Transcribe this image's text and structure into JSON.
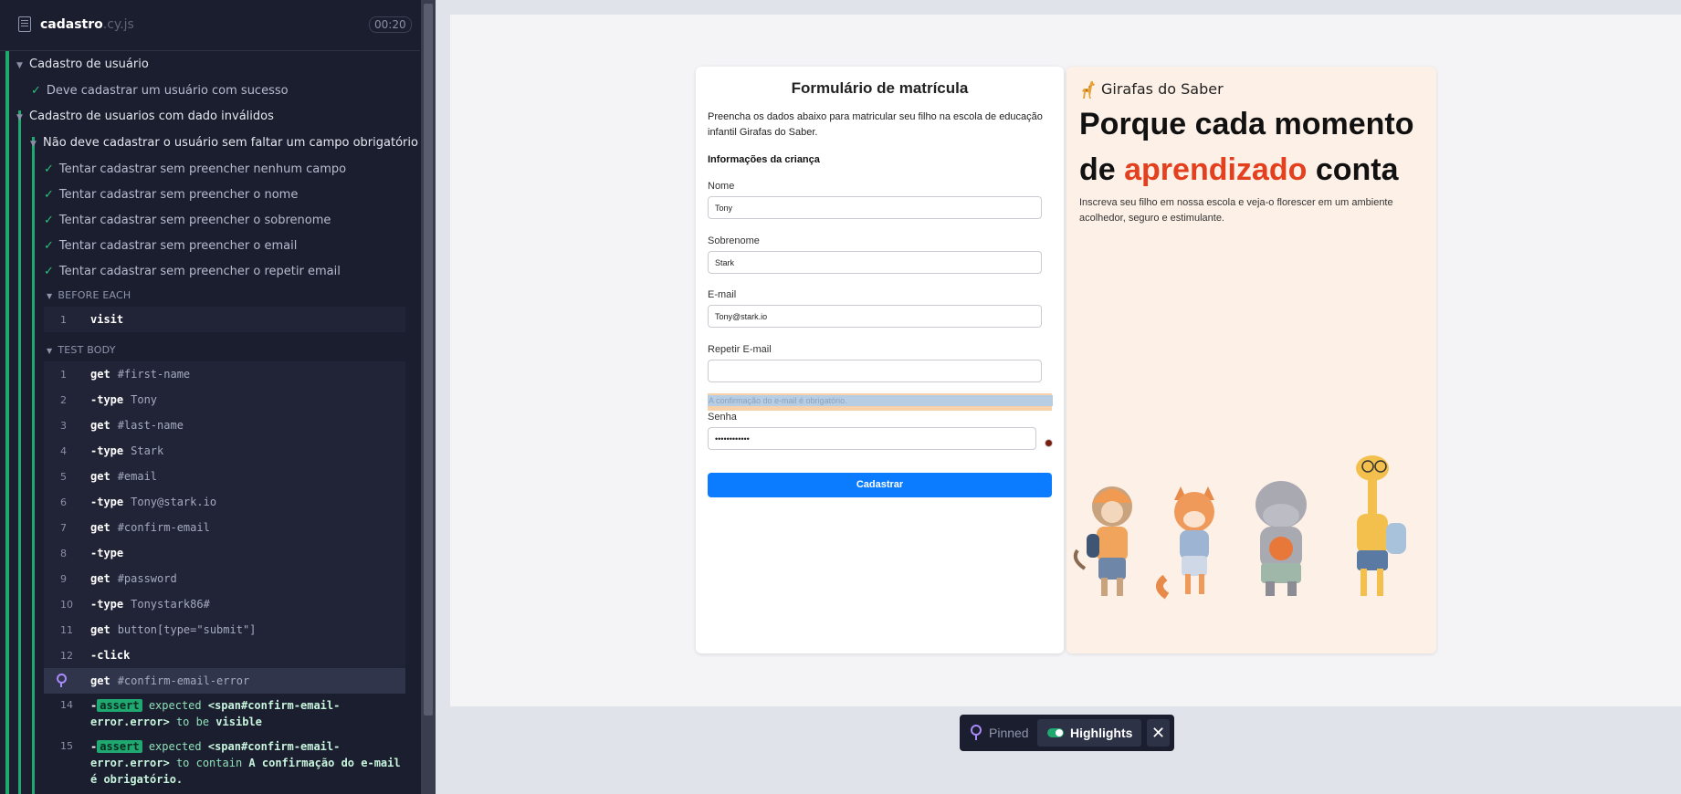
{
  "reporter": {
    "spec_name": "cadastro",
    "spec_ext": ".cy.js",
    "duration": "00:20",
    "suite1": "Cadastro de usuário",
    "test1": "Deve cadastrar um usuário com sucesso",
    "suite2": "Cadastro de usuarios com dado inválidos",
    "suite3": "Não deve cadastrar o usuário sem faltar um campo obrigatório",
    "tests": [
      "Tentar cadastrar sem preencher nenhum campo",
      "Tentar cadastrar sem preencher o nome",
      "Tentar cadastrar sem preencher o sobrenome",
      "Tentar cadastrar sem preencher o email",
      "Tentar cadastrar sem preencher o repetir email"
    ],
    "before_each": "BEFORE EACH",
    "before_cmd": {
      "num": "1",
      "name": "visit"
    },
    "test_body": "TEST BODY",
    "commands": [
      {
        "num": "1",
        "name": "get",
        "msg": "#first-name"
      },
      {
        "num": "2",
        "name": "-type",
        "msg": "Tony"
      },
      {
        "num": "3",
        "name": "get",
        "msg": "#last-name"
      },
      {
        "num": "4",
        "name": "-type",
        "msg": "Stark"
      },
      {
        "num": "5",
        "name": "get",
        "msg": "#email"
      },
      {
        "num": "6",
        "name": "-type",
        "msg": "Tony@stark.io"
      },
      {
        "num": "7",
        "name": "get",
        "msg": "#confirm-email"
      },
      {
        "num": "8",
        "name": "-type",
        "msg": ""
      },
      {
        "num": "9",
        "name": "get",
        "msg": "#password"
      },
      {
        "num": "10",
        "name": "-type",
        "msg": "Tonystark86#"
      },
      {
        "num": "11",
        "name": "get",
        "msg": "button[type=\"submit\"]"
      },
      {
        "num": "12",
        "name": "-click",
        "msg": ""
      },
      {
        "num": "",
        "name": "get",
        "msg": "#confirm-email-error"
      }
    ],
    "assert14": {
      "num": "14",
      "prefix": "-",
      "tag": "assert",
      "w1": "expected",
      "w2": "<span#confirm-email-error.error>",
      "w3": "to be",
      "w4": "visible"
    },
    "assert15": {
      "num": "15",
      "prefix": "-",
      "tag": "assert",
      "w1": "expected",
      "w2": "<span#confirm-email-error.error>",
      "w3": "to contain",
      "w4": "A confirmação do e-mail é obrigatório."
    }
  },
  "form": {
    "title": "Formulário de matrícula",
    "intro": "Preencha os dados abaixo para matricular seu filho na escola de educação infantil Girafas do Saber.",
    "section": "Informações da criança",
    "nome_label": "Nome",
    "nome_value": "Tony",
    "sobrenome_label": "Sobrenome",
    "sobrenome_value": "Stark",
    "email_label": "E-mail",
    "email_value": "Tony@stark.io",
    "repetir_label": "Repetir E-mail",
    "repetir_value": "",
    "error": "A confirmação do e-mail é obrigatório.",
    "senha_label": "Senha",
    "senha_value": "••••••••••••",
    "submit": "Cadastrar"
  },
  "promo": {
    "brand": "Girafas do Saber",
    "headline_1": "Porque cada momento de ",
    "headline_accent": "aprendizado",
    "headline_2": " conta",
    "sub": "Inscreva seu filho em nossa escola e veja-o florescer em um ambiente acolhedor, seguro e estimulante.",
    "accent_color": "#e2401f"
  },
  "pinbar": {
    "pinned": "Pinned",
    "highlights": "Highlights",
    "close": "✕"
  }
}
